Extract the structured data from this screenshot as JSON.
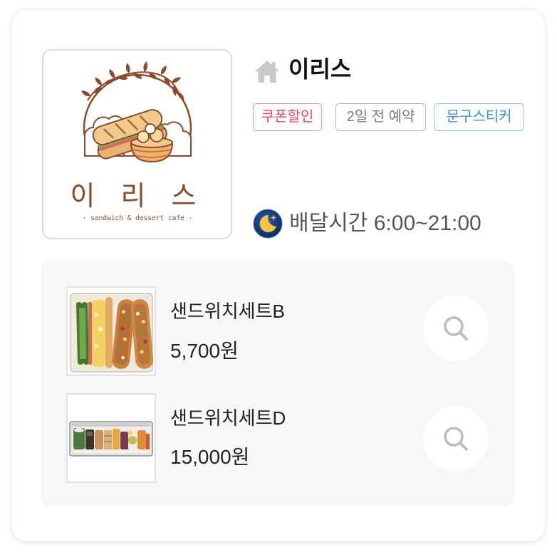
{
  "store": {
    "name": "이리스",
    "name_icon": "home-icon",
    "logo": {
      "title": "이 리 스",
      "subtitle": "· sandwich & dessert cafe ·",
      "color": "#8a4b2d"
    },
    "tags": [
      {
        "label": "쿠폰할인",
        "color": "#e6485a"
      },
      {
        "label": "2일 전 예약",
        "color": "#7b7b7b"
      },
      {
        "label": "문구스티커",
        "color": "#3b8fe3"
      }
    ],
    "delivery": {
      "icon": "moon-icon",
      "text": "배달시간 6:00~21:00"
    }
  },
  "menu": {
    "panel_color": "#f7f7f7",
    "items": [
      {
        "name": "샌드위치세트B",
        "price": "5,700원",
        "action_icon": "search-icon"
      },
      {
        "name": "샌드위치세트D",
        "price": "15,000원",
        "action_icon": "search-icon"
      }
    ]
  }
}
